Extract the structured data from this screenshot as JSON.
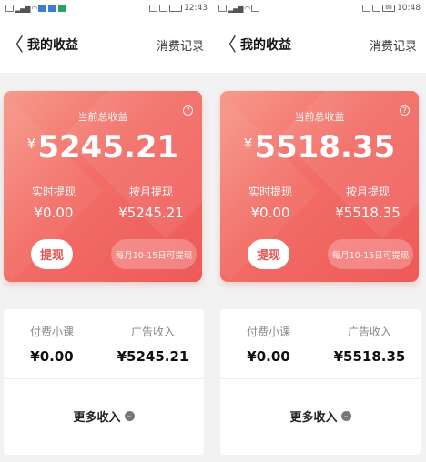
{
  "screens": [
    {
      "status": {
        "left_indicator": "",
        "time": "12:43",
        "battery": ""
      },
      "nav": {
        "back": "〈",
        "title": "我的收益",
        "right_link": "消费记录"
      },
      "card": {
        "total_label": "当前总收益",
        "currency": "¥",
        "total_amount": "5245.21",
        "realtime_label": "实时提现",
        "realtime_value": "¥0.00",
        "monthly_label": "按月提现",
        "monthly_value": "¥5245.21",
        "withdraw_button": "提现",
        "monthly_note": "每月10-15日可提现",
        "help": "?"
      },
      "income": {
        "paid_course_label": "付费小课",
        "paid_course_value": "¥0.00",
        "ad_income_label": "广告收入",
        "ad_income_value": "¥5245.21",
        "more_label": "更多收入",
        "more_icon": "⌄"
      }
    },
    {
      "status": {
        "left_indicator": "",
        "time": "10:48",
        "battery": "88"
      },
      "nav": {
        "back": "〈",
        "title": "我的收益",
        "right_link": "消费记录"
      },
      "card": {
        "total_label": "当前总收益",
        "currency": "¥",
        "total_amount": "5518.35",
        "realtime_label": "实时提现",
        "realtime_value": "¥0.00",
        "monthly_label": "按月提现",
        "monthly_value": "¥5518.35",
        "withdraw_button": "提现",
        "monthly_note": "每月10-15日可提现",
        "help": "?"
      },
      "income": {
        "paid_course_label": "付费小课",
        "paid_course_value": "¥0.00",
        "ad_income_label": "广告收入",
        "ad_income_value": "¥5518.35",
        "more_label": "更多收入",
        "more_icon": "⌄"
      }
    }
  ],
  "colors": {
    "card_gradient_start": "#f79a8c",
    "card_gradient_end": "#ee5a59",
    "withdraw_text": "#e9514f"
  }
}
